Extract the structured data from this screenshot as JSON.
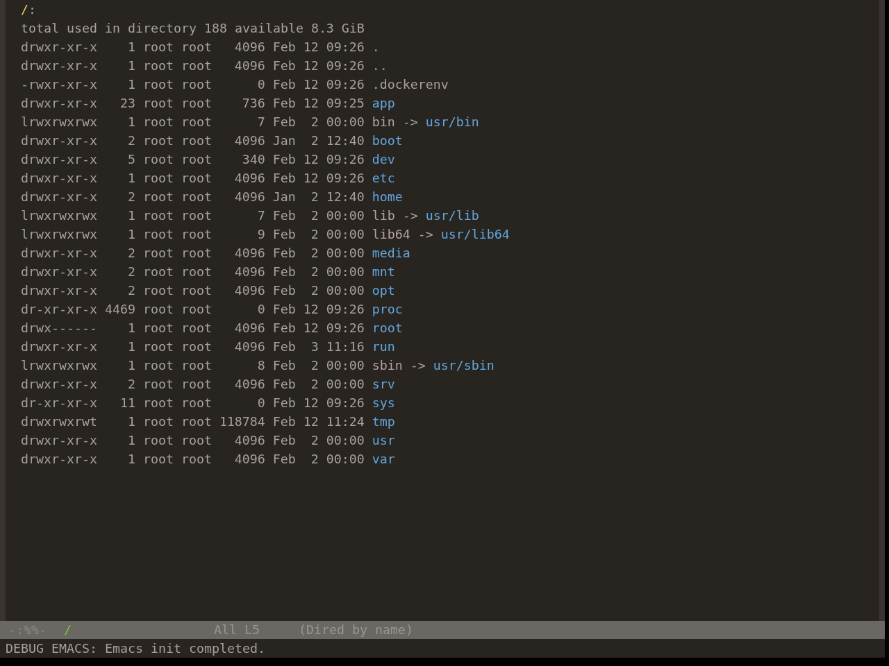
{
  "buffer": {
    "header": {
      "path": "/",
      "suffix": ":"
    },
    "summary": "total used in directory 188 available 8.3 GiB",
    "entries": [
      {
        "permissions": "drwxr-xr-x",
        "links": "1",
        "owner": "root",
        "group": "root",
        "size": "4096",
        "date": "Feb 12 09:26",
        "name": ".",
        "kind": "directory"
      },
      {
        "permissions": "drwxr-xr-x",
        "links": "1",
        "owner": "root",
        "group": "root",
        "size": "4096",
        "date": "Feb 12 09:26",
        "name": "..",
        "kind": "directory"
      },
      {
        "permissions": "-rwxr-xr-x",
        "links": "1",
        "owner": "root",
        "group": "root",
        "size": "0",
        "date": "Feb 12 09:26",
        "name": ".dockerenv",
        "kind": "file"
      },
      {
        "permissions": "drwxr-xr-x",
        "links": "23",
        "owner": "root",
        "group": "root",
        "size": "736",
        "date": "Feb 12 09:25",
        "name": "app",
        "kind": "directory"
      },
      {
        "permissions": "lrwxrwxrwx",
        "links": "1",
        "owner": "root",
        "group": "root",
        "size": "7",
        "date": "Feb  2 00:00",
        "name": "bin",
        "kind": "symlink",
        "arrow": "->",
        "target": "usr/bin"
      },
      {
        "permissions": "drwxr-xr-x",
        "links": "2",
        "owner": "root",
        "group": "root",
        "size": "4096",
        "date": "Jan  2 12:40",
        "name": "boot",
        "kind": "directory"
      },
      {
        "permissions": "drwxr-xr-x",
        "links": "5",
        "owner": "root",
        "group": "root",
        "size": "340",
        "date": "Feb 12 09:26",
        "name": "dev",
        "kind": "directory"
      },
      {
        "permissions": "drwxr-xr-x",
        "links": "1",
        "owner": "root",
        "group": "root",
        "size": "4096",
        "date": "Feb 12 09:26",
        "name": "etc",
        "kind": "directory"
      },
      {
        "permissions": "drwxr-xr-x",
        "links": "2",
        "owner": "root",
        "group": "root",
        "size": "4096",
        "date": "Jan  2 12:40",
        "name": "home",
        "kind": "directory"
      },
      {
        "permissions": "lrwxrwxrwx",
        "links": "1",
        "owner": "root",
        "group": "root",
        "size": "7",
        "date": "Feb  2 00:00",
        "name": "lib",
        "kind": "symlink",
        "arrow": "->",
        "target": "usr/lib"
      },
      {
        "permissions": "lrwxrwxrwx",
        "links": "1",
        "owner": "root",
        "group": "root",
        "size": "9",
        "date": "Feb  2 00:00",
        "name": "lib64",
        "kind": "symlink",
        "arrow": "->",
        "target": "usr/lib64"
      },
      {
        "permissions": "drwxr-xr-x",
        "links": "2",
        "owner": "root",
        "group": "root",
        "size": "4096",
        "date": "Feb  2 00:00",
        "name": "media",
        "kind": "directory"
      },
      {
        "permissions": "drwxr-xr-x",
        "links": "2",
        "owner": "root",
        "group": "root",
        "size": "4096",
        "date": "Feb  2 00:00",
        "name": "mnt",
        "kind": "directory"
      },
      {
        "permissions": "drwxr-xr-x",
        "links": "2",
        "owner": "root",
        "group": "root",
        "size": "4096",
        "date": "Feb  2 00:00",
        "name": "opt",
        "kind": "directory"
      },
      {
        "permissions": "dr-xr-xr-x",
        "links": "4469",
        "owner": "root",
        "group": "root",
        "size": "0",
        "date": "Feb 12 09:26",
        "name": "proc",
        "kind": "directory"
      },
      {
        "permissions": "drwx------",
        "links": "1",
        "owner": "root",
        "group": "root",
        "size": "4096",
        "date": "Feb 12 09:26",
        "name": "root",
        "kind": "directory"
      },
      {
        "permissions": "drwxr-xr-x",
        "links": "1",
        "owner": "root",
        "group": "root",
        "size": "4096",
        "date": "Feb  3 11:16",
        "name": "run",
        "kind": "directory"
      },
      {
        "permissions": "lrwxrwxrwx",
        "links": "1",
        "owner": "root",
        "group": "root",
        "size": "8",
        "date": "Feb  2 00:00",
        "name": "sbin",
        "kind": "symlink",
        "arrow": "->",
        "target": "usr/sbin"
      },
      {
        "permissions": "drwxr-xr-x",
        "links": "2",
        "owner": "root",
        "group": "root",
        "size": "4096",
        "date": "Feb  2 00:00",
        "name": "srv",
        "kind": "directory"
      },
      {
        "permissions": "dr-xr-xr-x",
        "links": "11",
        "owner": "root",
        "group": "root",
        "size": "0",
        "date": "Feb 12 09:26",
        "name": "sys",
        "kind": "directory"
      },
      {
        "permissions": "drwxrwxrwt",
        "links": "1",
        "owner": "root",
        "group": "root",
        "size": "118784",
        "date": "Feb 12 11:24",
        "name": "tmp",
        "kind": "directory"
      },
      {
        "permissions": "drwxr-xr-x",
        "links": "1",
        "owner": "root",
        "group": "root",
        "size": "4096",
        "date": "Feb  2 00:00",
        "name": "usr",
        "kind": "directory"
      },
      {
        "permissions": "drwxr-xr-x",
        "links": "1",
        "owner": "root",
        "group": "root",
        "size": "4096",
        "date": "Feb  2 00:00",
        "name": "var",
        "kind": "directory"
      }
    ]
  },
  "mode_line": {
    "status": "-:%%-",
    "buffer_name": "/",
    "position": "All L5",
    "mode": "(Dired by name)"
  },
  "echo_area": {
    "message": "DEBUG EMACS: Emacs init completed."
  }
}
